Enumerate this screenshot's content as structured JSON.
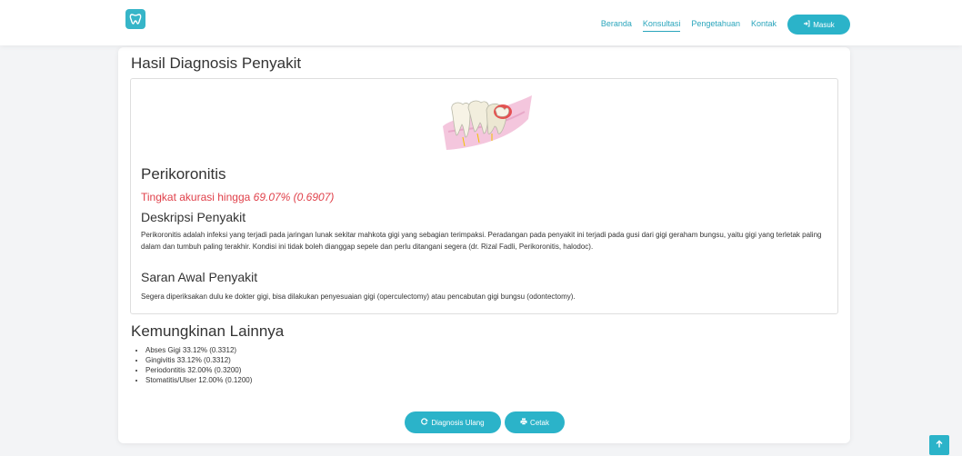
{
  "navbar": {
    "links": [
      {
        "label": "Beranda",
        "active": false
      },
      {
        "label": "Konsultasi",
        "active": true
      },
      {
        "label": "Pengetahuan",
        "active": false
      },
      {
        "label": "Kontak",
        "active": false
      }
    ],
    "login_label": "Masuk",
    "login_icon": "sign-in-icon",
    "logo_icon": "tooth-icon"
  },
  "page": {
    "title": "Hasil Diagnosis Penyakit"
  },
  "result": {
    "image_icon": "tooth-illustration",
    "disease_name": "Perikoronitis",
    "accuracy_prefix": "Tingkat akurasi hingga",
    "accuracy_value": "69.07% (0.6907)",
    "description_heading": "Deskripsi Penyakit",
    "description_text": "Perikoronitis adalah infeksi yang terjadi pada jaringan lunak sekitar mahkota gigi yang sebagian terimpaksi. Peradangan pada penyakit ini terjadi pada gusi dari gigi geraham bungsu, yaitu gigi yang terletak paling dalam dan tumbuh paling terakhir. Kondisi ini tidak boleh dianggap sepele dan perlu ditangani segera (dr. Rizal Fadli, Perikoronitis, halodoc).",
    "advice_heading": "Saran Awal Penyakit",
    "advice_text": "Segera diperiksakan dulu ke dokter gigi, bisa dilakukan penyesuaian gigi (operculectomy) atau pencabutan gigi bungsu (odontectomy)."
  },
  "other": {
    "heading": "Kemungkinan Lainnya",
    "items": [
      "Abses Gigi 33.12% (0.3312)",
      "Gingivitis 33.12% (0.3312)",
      "Periodontitis 32.00% (0.3200)",
      "Stomatitis/Ulser 12.00% (0.1200)"
    ]
  },
  "actions": {
    "diagnosis_again_label": "Diagnosis Ulang",
    "diagnosis_again_icon": "refresh-icon",
    "print_label": "Cetak",
    "print_icon": "print-icon"
  },
  "scroll_top_icon": "arrow-up-icon",
  "colors": {
    "accent": "#2bb3c9",
    "accuracy_red": "#e0404a"
  }
}
